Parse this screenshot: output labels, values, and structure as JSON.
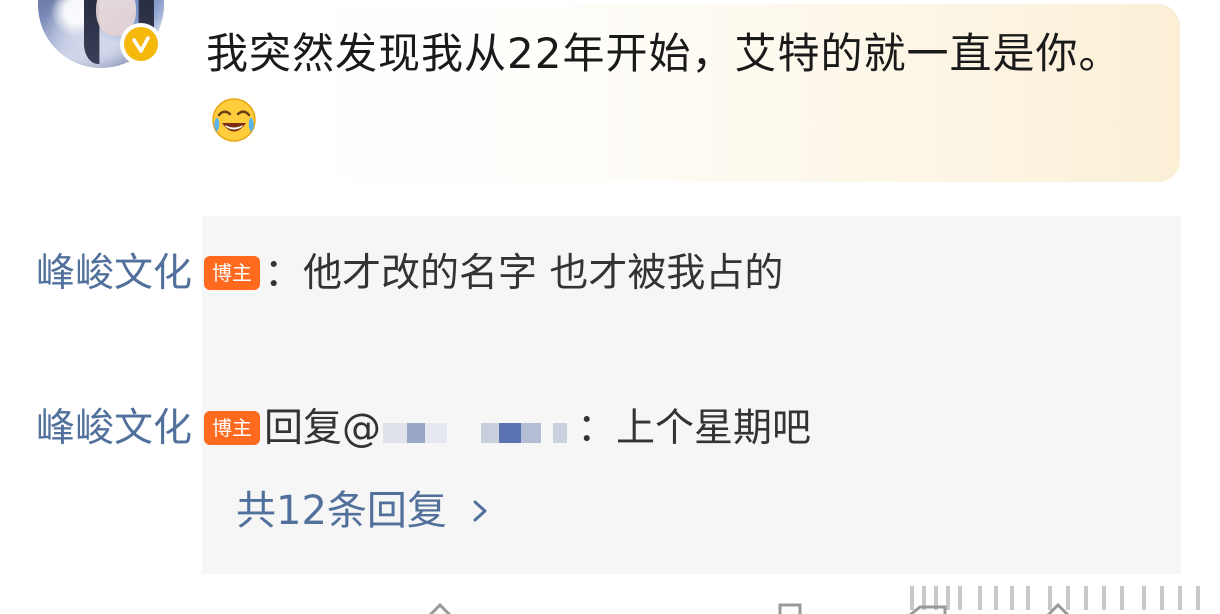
{
  "comment": {
    "avatar_icon": "user-avatar",
    "verified_icon": "verified-check-icon",
    "text": "我突然发现我从22年开始，艾特的就一直是你。",
    "emoji": "laughing-tears-emoji"
  },
  "replies": [
    {
      "author": "峰峻文化",
      "badge": "博主",
      "separator": "：",
      "content": "他才改的名字 也才被我占的"
    },
    {
      "author": "峰峻文化",
      "badge": "博主",
      "reply_label": "回复@",
      "mention_suffix": "：上个星期吧"
    }
  ],
  "view_all_label": "共12条回复",
  "view_all_icon": "chevron-right-icon",
  "colors": {
    "author_link": "#51709b",
    "badge": "#ff6a1f",
    "panel_bg": "#f6f6f6",
    "verified": "#f6b80a"
  }
}
